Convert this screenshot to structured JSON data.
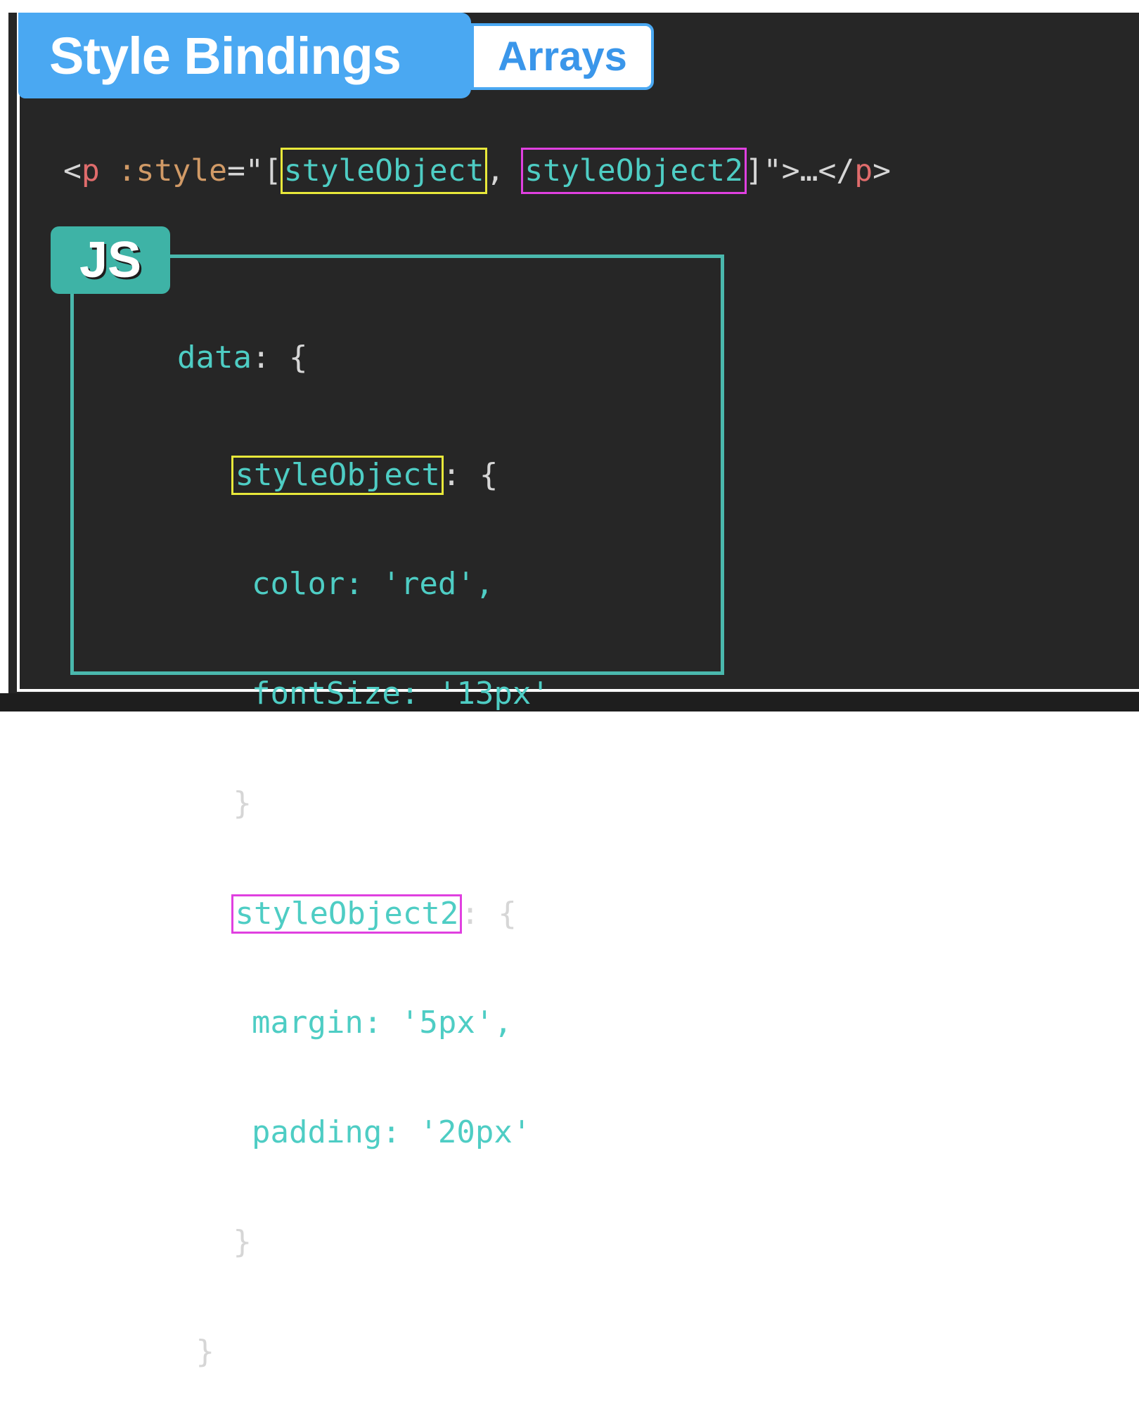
{
  "header": {
    "title": "Style Bindings",
    "subtitle": "Arrays"
  },
  "html_example": {
    "open_lt": "<",
    "tag": "p",
    "space": " ",
    "attr": ":style",
    "eq_quote_bracket": "=\"[",
    "item1": "styleObject",
    "comma": ", ",
    "item2": "styleObject2",
    "close_bracket_quote": "]\">…</",
    "close_tag": "p",
    "close_gt": ">"
  },
  "js_badge": {
    "label": "JS"
  },
  "code": {
    "line1_key": "data",
    "line1_rest": ": {",
    "obj1_key": "styleObject",
    "obj1_rest": ": {",
    "obj1_prop1": "color: 'red',",
    "obj1_prop2": "fontSize: '13px'",
    "obj1_close": "}",
    "obj2_key": "styleObject2",
    "obj2_rest": ": {",
    "obj2_prop1": "margin: '5px',",
    "obj2_prop2": "padding: '20px'",
    "obj2_close": "}",
    "data_close": "}"
  },
  "colors": {
    "title_bg": "#4aa8f2",
    "panel_bg": "#262626",
    "highlight_yellow": "#e8e83a",
    "highlight_magenta": "#e040e0",
    "js_teal": "#3eb3a6",
    "code_teal": "#4ecdc4",
    "tag_red": "#e06c6c",
    "attr_orange": "#d19a66"
  }
}
